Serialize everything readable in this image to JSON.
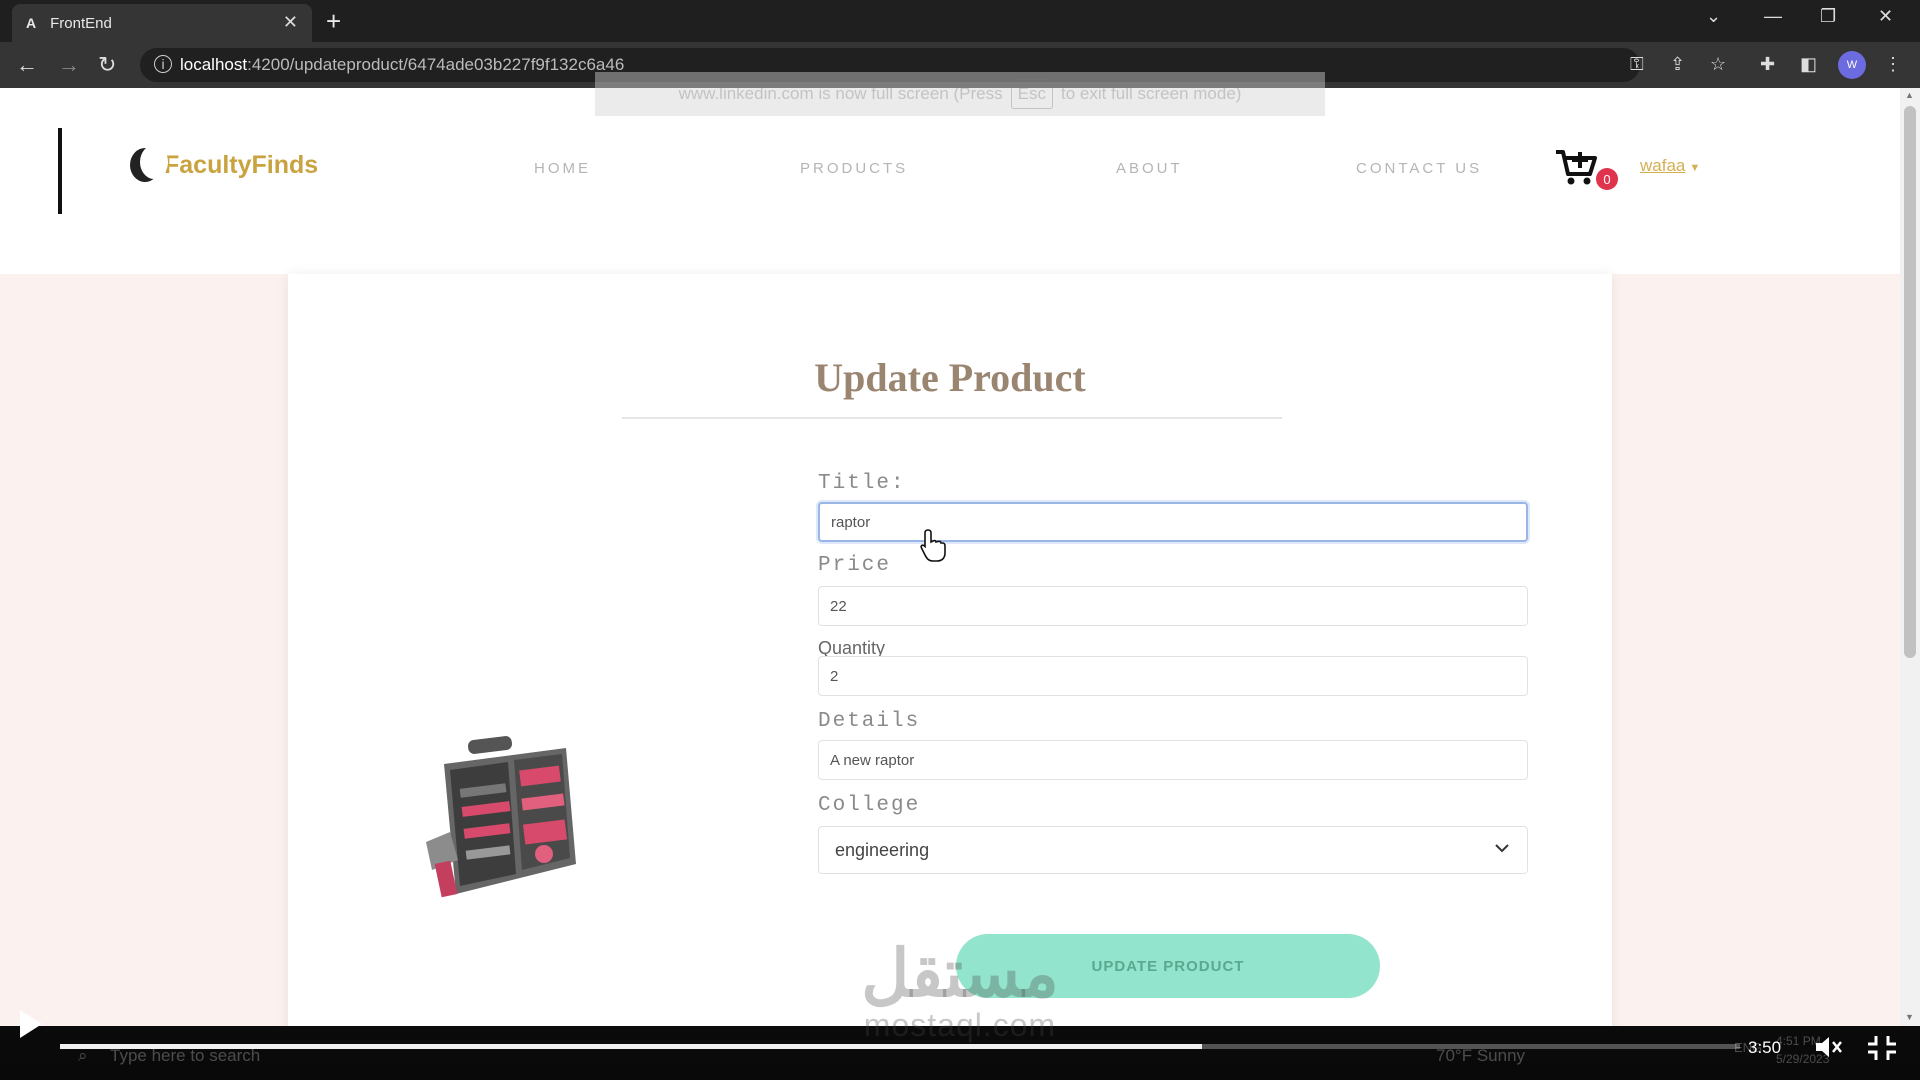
{
  "browser": {
    "tab_title": "FrontEnd",
    "tab_favicon": "A",
    "url_host": "localhost",
    "url_rest": ":4200/updateproduct/6474ade03b227f9f132c6a46",
    "fullscreen_notice_pre": "www.linkedin.com is now full screen (Press",
    "fullscreen_notice_key": "Esc",
    "fullscreen_notice_post": "to exit full screen mode)"
  },
  "header": {
    "brand": "FacultyFinds",
    "nav": {
      "home": "HOME",
      "products": "PRODUCTS",
      "about": "ABOUT",
      "contact": "CONTACT US"
    },
    "cart_count": "0",
    "user_name": "wafaa"
  },
  "form": {
    "heading": "Update Product",
    "title_label": "Title:",
    "title_value": "raptor",
    "price_label": "Price",
    "price_value": "22",
    "quantity_label": "Quantity",
    "quantity_value": "2",
    "details_label": "Details",
    "details_value": "A new raptor",
    "college_label": "College",
    "college_value": "engineering",
    "submit_label": "UPDATE PRODUCT"
  },
  "taskbar_ghost": {
    "search_placeholder": "Type here to search",
    "weather": "70°F Sunny",
    "lang": "ENG",
    "clock": "4:51 PM",
    "date": "5/29/2023"
  },
  "player": {
    "time": "3:50",
    "progress_fraction": 0.68
  },
  "watermark": {
    "arabic": "مستقل",
    "latin": "mostaql.com"
  },
  "colors": {
    "brand_gold": "#c9a33f",
    "button_mint": "#93e4cc",
    "badge_red": "#e0334d",
    "page_bg": "#fbf1ee"
  }
}
